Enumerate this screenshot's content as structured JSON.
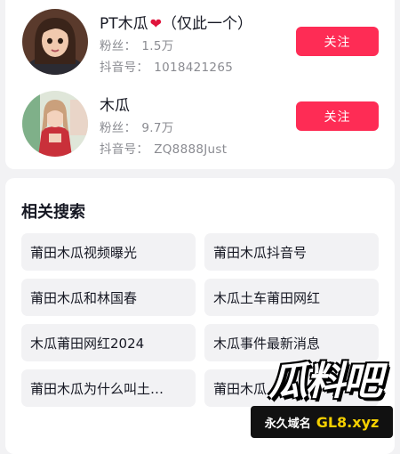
{
  "users": [
    {
      "name": "PT木瓜",
      "name_suffix": "（仅此一个）",
      "fans_label": "粉丝：",
      "fans": "1.5万",
      "id_label": "抖音号：",
      "id": "1018421265",
      "follow_label": "关注"
    },
    {
      "name": "木瓜",
      "fans_label": "粉丝：",
      "fans": "9.7万",
      "id_label": "抖音号：",
      "id": "ZQ8888Just",
      "follow_label": "关注"
    }
  ],
  "related": {
    "title": "相关搜索",
    "items": [
      "莆田木瓜视频曝光",
      "莆田木瓜抖音号",
      "莆田木瓜和林国春",
      "木瓜土车莆田网红",
      "木瓜莆田网红2024",
      "木瓜事件最新消息",
      "莆田木瓜为什么叫土…",
      "莆田木瓜"
    ]
  },
  "watermark": {
    "logo_text": "瓜料吧",
    "tagline": "永久域名",
    "domain": "GL8.xyz"
  },
  "colors": {
    "accent": "#fe2c55",
    "background": "#f2f2f4",
    "heart": "#e0143c"
  }
}
